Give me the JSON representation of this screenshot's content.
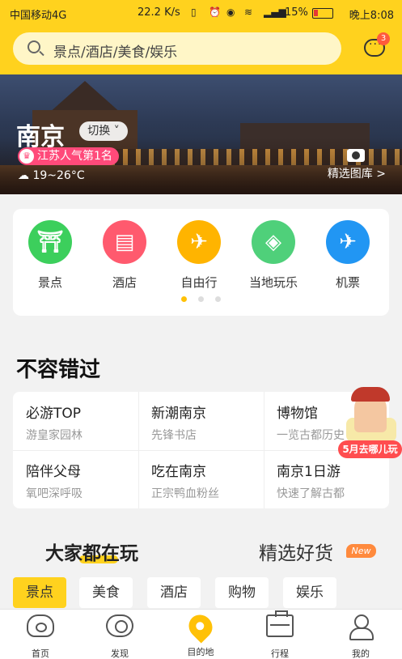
{
  "status_bar": {
    "carrier": "中国移动4G",
    "speed": "22.2 K/s",
    "battery": "15%",
    "time": "晚上8:08"
  },
  "search": {
    "placeholder": "景点/酒店/美食/娱乐"
  },
  "messages": {
    "badge": "3"
  },
  "hero": {
    "city": "南京",
    "switch_label": "切换",
    "ranking": "江苏人气第1名",
    "crown": "♛",
    "weather": "19~26°C",
    "gallery_label": "精选图库 >"
  },
  "categories": [
    {
      "label": "景点",
      "color": "#3ccf5c",
      "glyph": "⛩"
    },
    {
      "label": "酒店",
      "color": "#ff5a5a",
      "glyph": "▤"
    },
    {
      "label": "自由行",
      "color": "#ffb400",
      "glyph": "✈"
    },
    {
      "label": "当地玩乐",
      "color": "#4fd07a",
      "glyph": "◈"
    },
    {
      "label": "机票",
      "color": "#2196f3",
      "glyph": "✈"
    }
  ],
  "must_see": {
    "title": "不容错过",
    "items": [
      {
        "title": "必游TOP",
        "subtitle": "游皇家园林"
      },
      {
        "title": "新潮南京",
        "subtitle": "先锋书店"
      },
      {
        "title": "博物馆",
        "subtitle": "一览古都历史"
      },
      {
        "title": "陪伴父母",
        "subtitle": "氧吧深呼吸"
      },
      {
        "title": "吃在南京",
        "subtitle": "正宗鸭血粉丝"
      },
      {
        "title": "南京1日游",
        "subtitle": "快速了解古都"
      }
    ],
    "sticker_label": "5月去哪儿玩"
  },
  "section_tabs": {
    "tab1": "大家都在玩",
    "tab2": "精选好货",
    "new_badge": "New"
  },
  "chips": [
    "景点",
    "美食",
    "酒店",
    "购物",
    "娱乐"
  ],
  "bottom_nav": [
    "首页",
    "发现",
    "目的地",
    "行程",
    "我的"
  ]
}
